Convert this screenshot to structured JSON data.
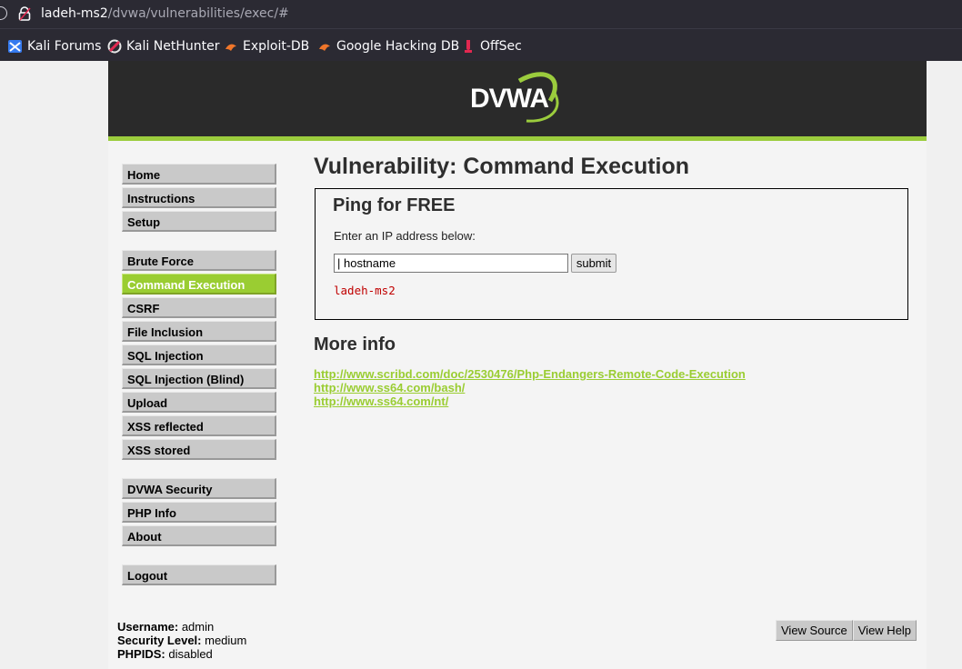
{
  "browser": {
    "url_host": "ladeh-ms2",
    "url_path": "/dvwa/vulnerabilities/exec/#",
    "bookmarks": [
      {
        "label": "Kali Forums",
        "icon": "kali-forums-icon"
      },
      {
        "label": "Kali NetHunter",
        "icon": "kali-nethunter-icon"
      },
      {
        "label": "Exploit-DB",
        "icon": "exploit-db-icon"
      },
      {
        "label": "Google Hacking DB",
        "icon": "google-hacking-db-icon"
      },
      {
        "label": "OffSec",
        "icon": "offsec-icon"
      }
    ]
  },
  "header": {
    "logo_text": "DVWA",
    "accent_color": "#9bcc3d"
  },
  "menu": {
    "items": [
      {
        "label": "Home"
      },
      {
        "label": "Instructions"
      },
      {
        "label": "Setup"
      },
      {
        "label": "Brute Force"
      },
      {
        "label": "Command Execution",
        "active": true
      },
      {
        "label": "CSRF"
      },
      {
        "label": "File Inclusion"
      },
      {
        "label": "SQL Injection"
      },
      {
        "label": "SQL Injection (Blind)"
      },
      {
        "label": "Upload"
      },
      {
        "label": "XSS reflected"
      },
      {
        "label": "XSS stored"
      },
      {
        "label": "DVWA Security"
      },
      {
        "label": "PHP Info"
      },
      {
        "label": "About"
      },
      {
        "label": "Logout"
      }
    ]
  },
  "main": {
    "title": "Vulnerability: Command Execution",
    "ping": {
      "heading": "Ping for FREE",
      "prompt": "Enter an IP address below:",
      "input_value": "| hostname",
      "submit_label": "submit",
      "output": "ladeh-ms2"
    },
    "more_info": {
      "heading": "More info",
      "links": [
        "http://www.scribd.com/doc/2530476/Php-Endangers-Remote-Code-Execution",
        "http://www.ss64.com/bash/",
        "http://www.ss64.com/nt/"
      ]
    }
  },
  "footer": {
    "username_label": "Username:",
    "username": "admin",
    "security_label": "Security Level:",
    "security": "medium",
    "phpids_label": "PHPIDS:",
    "phpids": "disabled",
    "view_source_label": "View Source",
    "view_help_label": "View Help"
  }
}
